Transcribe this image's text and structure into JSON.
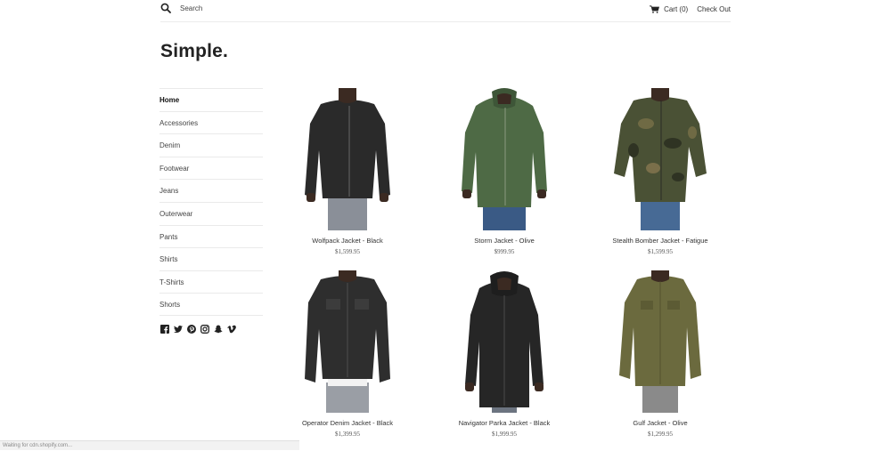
{
  "header": {
    "search_placeholder": "Search",
    "cart_label": "Cart (0)",
    "checkout_label": "Check Out"
  },
  "shop": {
    "logo": "Simple."
  },
  "sidebar": {
    "items": [
      {
        "label": "Home"
      },
      {
        "label": "Accessories"
      },
      {
        "label": "Denim"
      },
      {
        "label": "Footwear"
      },
      {
        "label": "Jeans"
      },
      {
        "label": "Outerwear"
      },
      {
        "label": "Pants"
      },
      {
        "label": "Shirts"
      },
      {
        "label": "T-Shirts"
      },
      {
        "label": "Shorts"
      }
    ],
    "social_icons": [
      "facebook-icon",
      "twitter-icon",
      "pinterest-icon",
      "instagram-icon",
      "snapchat-icon",
      "vimeo-icon"
    ]
  },
  "products": [
    {
      "name": "Wolfpack Jacket - Black",
      "price": "$1,599.95",
      "jacket_color": "#2a2a2a",
      "pants_color": "#8a8f98"
    },
    {
      "name": "Storm Jacket - Olive",
      "price": "$999.95",
      "jacket_color": "#4e6a45",
      "pants_color": "#3a5a85"
    },
    {
      "name": "Stealth Bomber Jacket - Fatigue",
      "price": "$1,599.95",
      "jacket_color": "#4a5135",
      "pants_color": "#476a95"
    },
    {
      "name": "Operator Denim Jacket - Black",
      "price": "$1,399.95",
      "jacket_color": "#2e2e2e",
      "pants_color": "#9a9ea5"
    },
    {
      "name": "Navigator Parka Jacket - Black",
      "price": "$1,999.95",
      "jacket_color": "#262626",
      "pants_color": "#6c7480"
    },
    {
      "name": "Gulf Jacket - Olive",
      "price": "$1,299.95",
      "jacket_color": "#6b6a3e",
      "pants_color": "#8a8a8a"
    }
  ],
  "status": {
    "text": "Waiting for cdn.shopify.com..."
  }
}
